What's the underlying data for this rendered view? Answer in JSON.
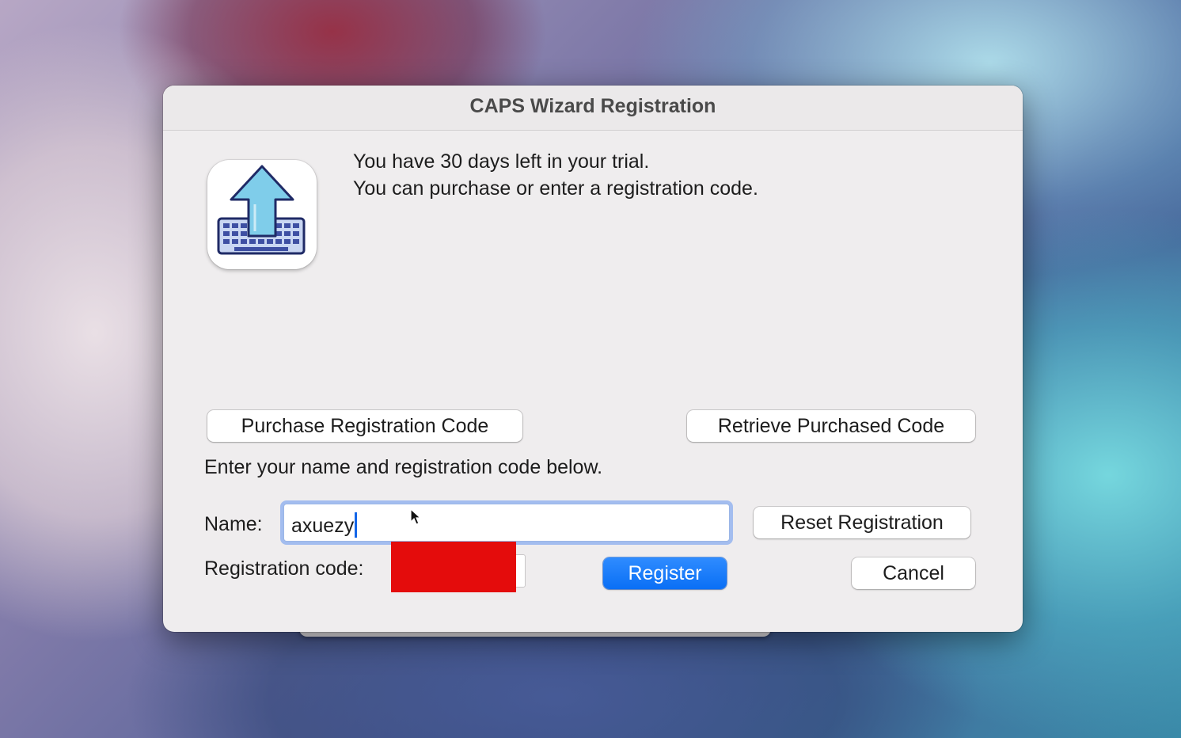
{
  "window": {
    "title": "CAPS Wizard Registration"
  },
  "app_icon": {
    "name": "caps-wizard-app-icon",
    "colors": {
      "arrow": "#7fcdea",
      "keyboard": "#3e4fa3",
      "outline": "#1f2a66"
    }
  },
  "message": {
    "line1": "You have 30 days left in your trial.",
    "line2": "You can purchase or enter a registration code."
  },
  "buttons": {
    "purchase": "Purchase Registration Code",
    "retrieve": "Retrieve Purchased Code",
    "reset": "Reset Registration",
    "register": "Register",
    "cancel": "Cancel"
  },
  "instructions": "Enter your name and registration code below.",
  "form": {
    "name_label": "Name:",
    "name_value": "axuezy",
    "code_label": "Registration code:",
    "code_value": ""
  },
  "colors": {
    "accent": "#0a6ff5",
    "redaction": "#e40c0c",
    "focus_ring": "#6496f0"
  }
}
